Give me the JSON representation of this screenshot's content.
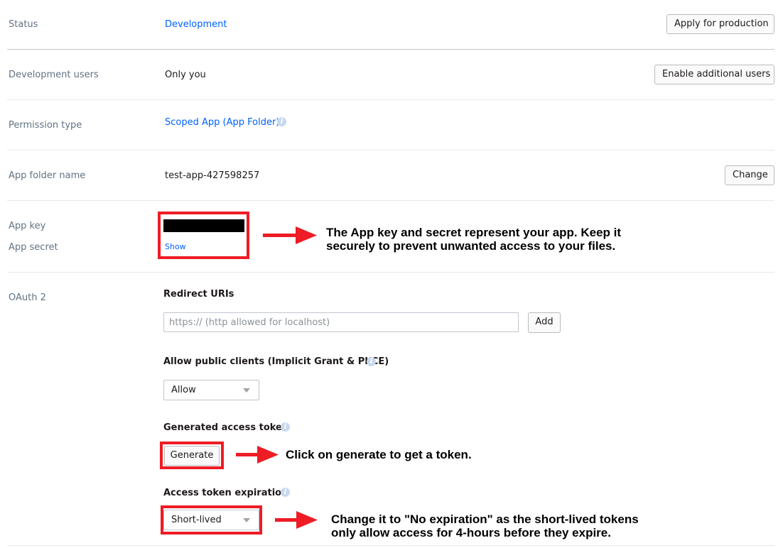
{
  "status": {
    "label": "Status",
    "value": "Development",
    "button": "Apply for production"
  },
  "dev_users": {
    "label": "Development users",
    "value": "Only you",
    "button": "Enable additional users"
  },
  "permission": {
    "label": "Permission type",
    "value": "Scoped App (App Folder)",
    "info_icon": "info-icon"
  },
  "app_folder": {
    "label": "App folder name",
    "value": "test-app-427598257",
    "button": "Change"
  },
  "keys": {
    "app_key_label": "App key",
    "app_secret_label": "App secret",
    "show_link": "Show"
  },
  "oauth": {
    "label": "OAuth 2",
    "redirect_title": "Redirect URIs",
    "redirect_placeholder": "https:// (http allowed for localhost)",
    "add_button": "Add",
    "public_clients_title": "Allow public clients (Implicit Grant & PKCE)",
    "public_clients_value": "Allow",
    "token_title": "Generated access token",
    "generate_button": "Generate",
    "expiration_title": "Access token expiration",
    "expiration_value": "Short-lived"
  },
  "annotations": {
    "keys_line1": "The App key and secret represent your app. Keep it",
    "keys_line2": "securely to prevent unwanted access to your files.",
    "generate_text": "Click on generate to get a token.",
    "expiration_line1": "Change it to \"No expiration\" as the short-lived tokens",
    "expiration_line2": "only allow access for 4-hours before they expire."
  },
  "colors": {
    "link": "#0061fe",
    "highlight": "#ee1c25",
    "muted_label": "#637282"
  }
}
